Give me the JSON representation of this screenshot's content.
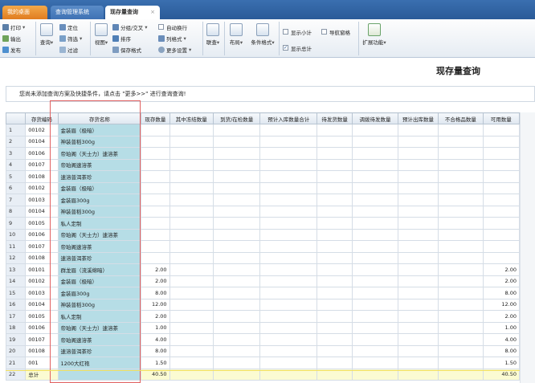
{
  "tabs": [
    {
      "label": "我的桌面"
    },
    {
      "label": "查询管理系统"
    },
    {
      "label": "现存量查询",
      "close": "×"
    }
  ],
  "toolbar": {
    "print": "打印",
    "output": "输出",
    "publish": "发布",
    "query": "查询",
    "locate": "定位",
    "filter": "筛选",
    "filter2": "过滤",
    "view": "视图",
    "group": "分组/交叉",
    "sort": "排序",
    "save_format": "保存格式",
    "auto_wrap": "自动换行",
    "column_format": "列格式",
    "more_settings": "更多设置",
    "link_query": "联查",
    "layout": "布局",
    "condition_format": "条件格式",
    "show_subtotal": "显示小计",
    "nav_window": "导航窗格",
    "show_total": "显示总计",
    "extend": "扩展功能"
  },
  "page_title": "现存量查询",
  "hint": "您尚未添加查询方案及快捷条件，请点击 \"更多>>\" 进行查询查询!",
  "grid": {
    "headers": [
      "存货编码",
      "存货名称",
      "现存数量",
      "其中冻结数量",
      "到货/在检数量",
      "预计入库数量合计",
      "待发货数量",
      "调拨待发数量",
      "预计出库数量",
      "不合格品数量",
      "可用数量"
    ],
    "rows": [
      {
        "n": "1",
        "code": "00102",
        "name": "金装眉（极暗）",
        "qty": "",
        "avail": ""
      },
      {
        "n": "2",
        "code": "00104",
        "name": "神装普稻300g",
        "qty": "",
        "avail": ""
      },
      {
        "n": "3",
        "code": "00106",
        "name": "帝珀阁（天士力）速溶茶",
        "qty": "",
        "avail": ""
      },
      {
        "n": "4",
        "code": "00107",
        "name": "帝珀阁速溶茶",
        "qty": "",
        "avail": ""
      },
      {
        "n": "5",
        "code": "00108",
        "name": "速溶普洱茶珍",
        "qty": "",
        "avail": ""
      },
      {
        "n": "6",
        "code": "00102",
        "name": "金装眉（极暗）",
        "qty": "",
        "avail": ""
      },
      {
        "n": "7",
        "code": "00103",
        "name": "金装眉300g",
        "qty": "",
        "avail": ""
      },
      {
        "n": "8",
        "code": "00104",
        "name": "神装普稻300g",
        "qty": "",
        "avail": ""
      },
      {
        "n": "9",
        "code": "00105",
        "name": "私人定制",
        "qty": "",
        "avail": ""
      },
      {
        "n": "10",
        "code": "00106",
        "name": "帝珀阁（天士力）速溶茶",
        "qty": "",
        "avail": ""
      },
      {
        "n": "11",
        "code": "00107",
        "name": "帝珀阁速溶茶",
        "qty": "",
        "avail": ""
      },
      {
        "n": "12",
        "code": "00108",
        "name": "速溶普洱茶珍",
        "qty": "",
        "avail": ""
      },
      {
        "n": "13",
        "code": "00101",
        "name": "群龙眉（流溪绵暗）",
        "qty": "2.00",
        "avail": "2.00"
      },
      {
        "n": "14",
        "code": "00102",
        "name": "金装眉（极暗）",
        "qty": "2.00",
        "avail": "2.00"
      },
      {
        "n": "15",
        "code": "00103",
        "name": "金装眉300g",
        "qty": "8.00",
        "avail": "8.00"
      },
      {
        "n": "16",
        "code": "00104",
        "name": "神装普稻300g",
        "qty": "12.00",
        "avail": "12.00"
      },
      {
        "n": "17",
        "code": "00105",
        "name": "私人定制",
        "qty": "2.00",
        "avail": "2.00"
      },
      {
        "n": "18",
        "code": "00106",
        "name": "帝珀阁（天士力）速溶茶",
        "qty": "1.00",
        "avail": "1.00"
      },
      {
        "n": "19",
        "code": "00107",
        "name": "帝珀阁速溶茶",
        "qty": "4.00",
        "avail": "4.00"
      },
      {
        "n": "20",
        "code": "00108",
        "name": "速溶普洱茶珍",
        "qty": "8.00",
        "avail": "8.00"
      },
      {
        "n": "21",
        "code": "001",
        "name": "1200大红袍",
        "qty": "1.50",
        "avail": "1.50"
      }
    ],
    "total": {
      "n": "22",
      "code": "总计",
      "qty": "40.50",
      "avail": "40.50"
    }
  }
}
